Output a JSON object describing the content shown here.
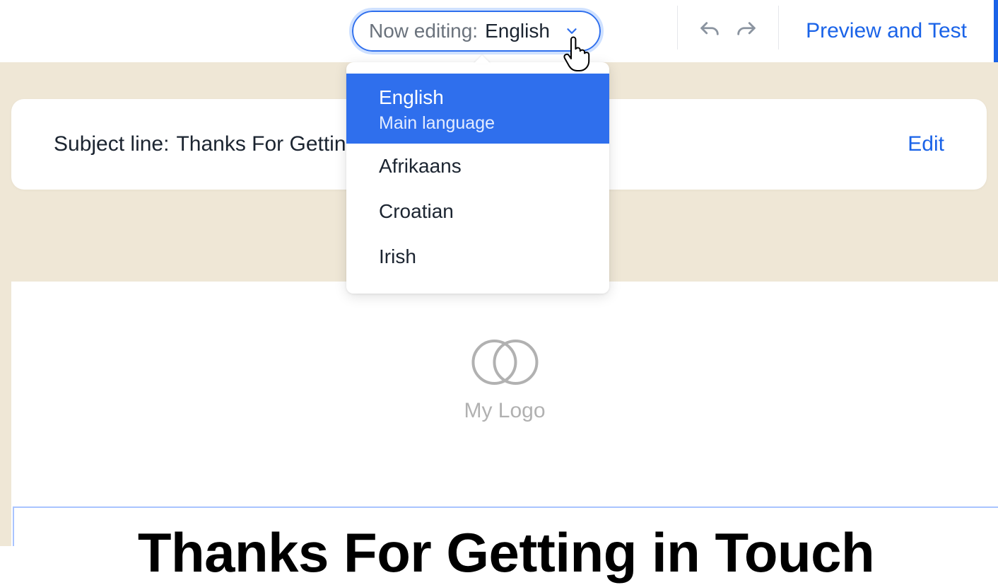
{
  "toolbar": {
    "language_switcher": {
      "label": "Now editing:",
      "value": "English"
    },
    "preview_label": "Preview and Test"
  },
  "language_dropdown": {
    "items": [
      {
        "label": "English",
        "sublabel": "Main language",
        "selected": true
      },
      {
        "label": "Afrikaans",
        "sublabel": "",
        "selected": false
      },
      {
        "label": "Croatian",
        "sublabel": "",
        "selected": false
      },
      {
        "label": "Irish",
        "sublabel": "",
        "selected": false
      }
    ]
  },
  "subject_card": {
    "label": "Subject line:",
    "value": "Thanks For Getting in Touch",
    "edit_label": "Edit"
  },
  "email": {
    "logo_text": "My Logo",
    "headline": "Thanks For Getting in Touch"
  },
  "colors": {
    "accent": "#2f6fed",
    "link": "#1a63e8",
    "canvas": "#efe7d6"
  }
}
